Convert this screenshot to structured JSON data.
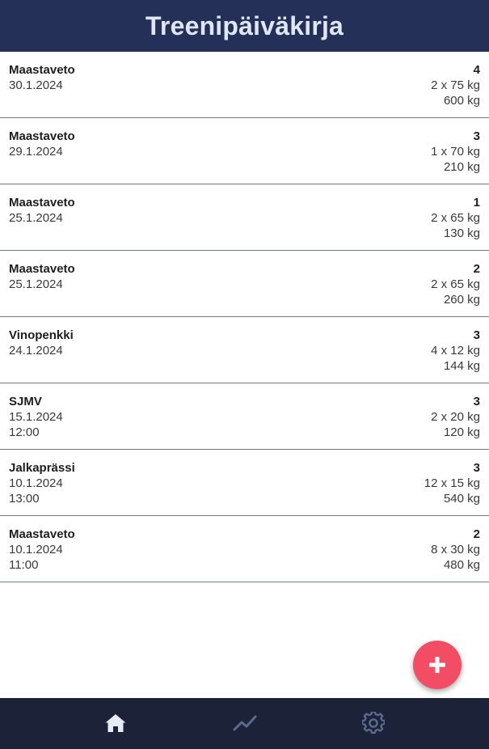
{
  "header": {
    "title": "Treenipäiväkirja"
  },
  "workouts": [
    {
      "exercise": "Maastaveto",
      "date": "30.1.2024",
      "time": "",
      "sets": "4",
      "reps_weight": "2 x 75 kg",
      "total": "600 kg"
    },
    {
      "exercise": "Maastaveto",
      "date": "29.1.2024",
      "time": "",
      "sets": "3",
      "reps_weight": "1 x 70 kg",
      "total": "210 kg"
    },
    {
      "exercise": "Maastaveto",
      "date": "25.1.2024",
      "time": "",
      "sets": "1",
      "reps_weight": "2 x 65 kg",
      "total": "130 kg"
    },
    {
      "exercise": "Maastaveto",
      "date": "25.1.2024",
      "time": "",
      "sets": "2",
      "reps_weight": "2 x 65 kg",
      "total": "260 kg"
    },
    {
      "exercise": "Vinopenkki",
      "date": "24.1.2024",
      "time": "",
      "sets": "3",
      "reps_weight": "4 x 12 kg",
      "total": "144 kg"
    },
    {
      "exercise": "SJMV",
      "date": "15.1.2024",
      "time": "12:00",
      "sets": "3",
      "reps_weight": "2 x 20 kg",
      "total": "120 kg"
    },
    {
      "exercise": "Jalkaprässi",
      "date": "10.1.2024",
      "time": "13:00",
      "sets": "3",
      "reps_weight": "12 x 15 kg",
      "total": "540 kg"
    },
    {
      "exercise": "Maastaveto",
      "date": "10.1.2024",
      "time": "11:00",
      "sets": "2",
      "reps_weight": "8 x 30 kg",
      "total": "480 kg"
    }
  ],
  "fab": {
    "icon": "plus-icon"
  },
  "nav": {
    "items": [
      {
        "icon": "home-icon",
        "active": true
      },
      {
        "icon": "chart-icon",
        "active": false
      },
      {
        "icon": "gear-icon",
        "active": false
      }
    ]
  },
  "colors": {
    "header_bg": "#243058",
    "header_text": "#dfe6f6",
    "nav_bg": "#1c2238",
    "nav_active": "#e6ebf5",
    "nav_inactive": "#5b6a8e",
    "fab_bg": "#f24d64",
    "divider": "#6b7f7f"
  }
}
